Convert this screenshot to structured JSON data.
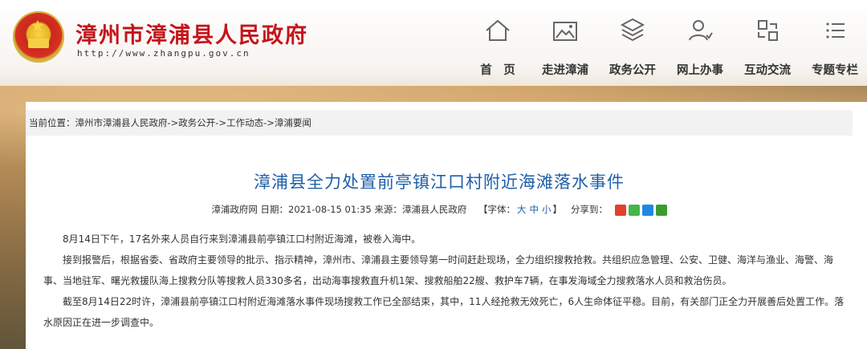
{
  "site": {
    "title": "漳州市漳浦县人民政府",
    "url": "http://www.zhangpu.gov.cn"
  },
  "nav": [
    {
      "label": "首　页",
      "icon": "home-icon"
    },
    {
      "label": "走进漳浦",
      "icon": "picture-icon"
    },
    {
      "label": "政务公开",
      "icon": "layers-icon"
    },
    {
      "label": "网上办事",
      "icon": "user-check-icon"
    },
    {
      "label": "互动交流",
      "icon": "exchange-icon"
    },
    {
      "label": "专题专栏",
      "icon": "list-icon"
    }
  ],
  "breadcrumb": "当前位置：漳州市漳浦县人民政府->政务公开->工作动态->漳浦要闻",
  "article": {
    "title": "漳浦县全力处置前亭镇江口村附近海滩落水事件",
    "meta_source": "漳浦政府网 日期：2021-08-15 01:35  来源：漳浦县人民政府",
    "font_label": "【字体：",
    "font_large": "大",
    "font_medium": "中",
    "font_small": "小",
    "font_end": "】",
    "share_label": "分享到：",
    "paragraphs": [
      "8月14日下午，17名外来人员自行来到漳浦县前亭镇江口村附近海滩，被卷入海中。",
      "接到报警后，根据省委、省政府主要领导的批示、指示精神，漳州市、漳浦县主要领导第一时间赶赴现场，全力组织搜救抢救。共组织应急管理、公安、卫健、海洋与渔业、海警、海事、当地驻军、曙光救援队海上搜救分队等搜救人员330多名，出动海事搜救直升机1架、搜救船舶22艘、救护车7辆，在事发海域全力搜救落水人员和救治伤员。",
      "截至8月14日22时许，漳浦县前亭镇江口村附近海滩落水事件现场搜救工作已全部结束，其中，11人经抢救无效死亡，6人生命体征平稳。目前，有关部门正全力开展善后处置工作。落水原因正在进一步调查中。"
    ]
  },
  "colors": {
    "brand_red": "#c3151b",
    "title_blue": "#1f5fa8",
    "share_weibo": "#e2412c",
    "share_wechat": "#44b549",
    "share_qq": "#1e88e5",
    "share_douban": "#3a9c2f"
  }
}
